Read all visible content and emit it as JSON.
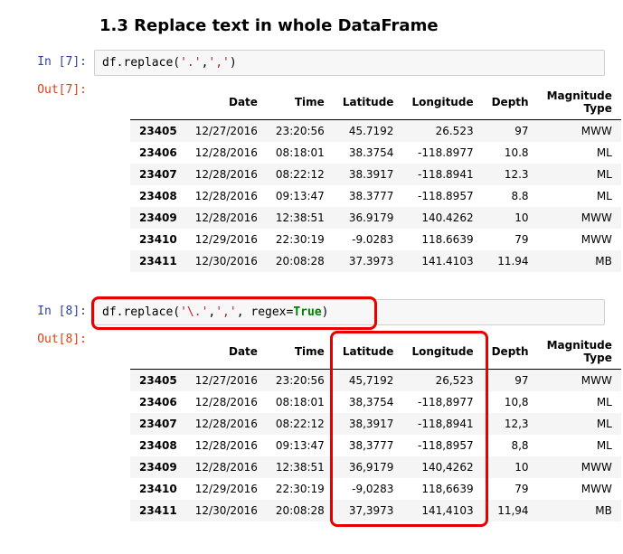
{
  "section": {
    "title": "1.3  Replace text in whole DataFrame"
  },
  "cell7": {
    "in_prompt": "In [7]:",
    "out_prompt": "Out[7]:",
    "code_pre": "df.replace(",
    "s1": "'.'",
    "comma": ",",
    "s2": "','",
    "code_post": ")",
    "table": {
      "columns": [
        "Date",
        "Time",
        "Latitude",
        "Longitude",
        "Depth",
        "Magnitude Type"
      ],
      "index": [
        "23405",
        "23406",
        "23407",
        "23408",
        "23409",
        "23410",
        "23411"
      ],
      "rows": [
        [
          "12/27/2016",
          "23:20:56",
          "45.7192",
          "26.523",
          "97",
          "MWW"
        ],
        [
          "12/28/2016",
          "08:18:01",
          "38.3754",
          "-118.8977",
          "10.8",
          "ML"
        ],
        [
          "12/28/2016",
          "08:22:12",
          "38.3917",
          "-118.8941",
          "12.3",
          "ML"
        ],
        [
          "12/28/2016",
          "09:13:47",
          "38.3777",
          "-118.8957",
          "8.8",
          "ML"
        ],
        [
          "12/28/2016",
          "12:38:51",
          "36.9179",
          "140.4262",
          "10",
          "MWW"
        ],
        [
          "12/29/2016",
          "22:30:19",
          "-9.0283",
          "118.6639",
          "79",
          "MWW"
        ],
        [
          "12/30/2016",
          "20:08:28",
          "37.3973",
          "141.4103",
          "11.94",
          "MB"
        ]
      ]
    }
  },
  "cell8": {
    "in_prompt": "In [8]:",
    "out_prompt": "Out[8]:",
    "code_pre": "df.replace(",
    "s1": "'\\.'",
    "comma1": ",",
    "s2": "','",
    "comma2": ", regex=",
    "kw": "True",
    "code_post": ")",
    "table": {
      "columns": [
        "Date",
        "Time",
        "Latitude",
        "Longitude",
        "Depth",
        "Magnitude Type"
      ],
      "index": [
        "23405",
        "23406",
        "23407",
        "23408",
        "23409",
        "23410",
        "23411"
      ],
      "rows": [
        [
          "12/27/2016",
          "23:20:56",
          "45,7192",
          "26,523",
          "97",
          "MWW"
        ],
        [
          "12/28/2016",
          "08:18:01",
          "38,3754",
          "-118,8977",
          "10,8",
          "ML"
        ],
        [
          "12/28/2016",
          "08:22:12",
          "38,3917",
          "-118,8941",
          "12,3",
          "ML"
        ],
        [
          "12/28/2016",
          "09:13:47",
          "38,3777",
          "-118,8957",
          "8,8",
          "ML"
        ],
        [
          "12/28/2016",
          "12:38:51",
          "36,9179",
          "140,4262",
          "10",
          "MWW"
        ],
        [
          "12/29/2016",
          "22:30:19",
          "-9,0283",
          "118,6639",
          "79",
          "MWW"
        ],
        [
          "12/30/2016",
          "20:08:28",
          "37,3973",
          "141,4103",
          "11,94",
          "MB"
        ]
      ]
    }
  }
}
